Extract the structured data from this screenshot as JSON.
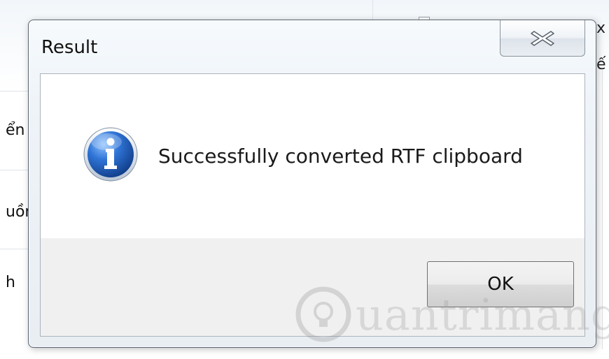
{
  "background": {
    "left_labels": [
      "ển",
      "uồn",
      "h"
    ],
    "right_chars": [
      "x",
      "ế"
    ]
  },
  "dialog": {
    "title": "Result",
    "close_glyph": "✕",
    "message": "Successfully converted RTF clipboard",
    "icon": "info-icon",
    "ok_label": "OK"
  },
  "watermark": {
    "text": "uantrimang"
  },
  "colors": {
    "icon_blue": "#1f5fb5",
    "title_bar": "#eef3f8"
  }
}
